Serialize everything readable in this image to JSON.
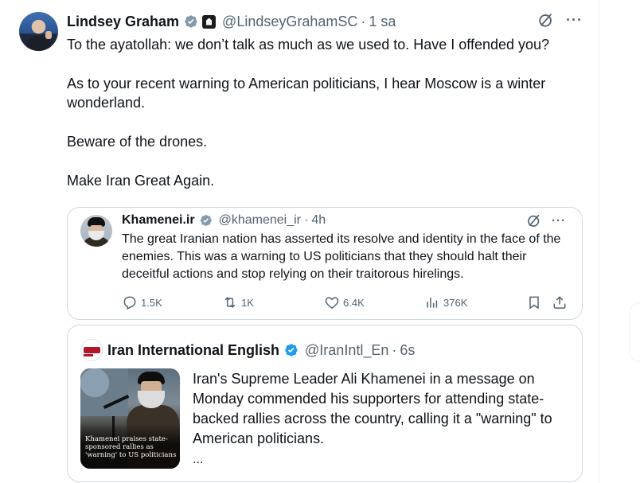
{
  "main_tweet": {
    "author_name": "Lindsey Graham",
    "handle": "@LindseyGrahamSC",
    "separator": "·",
    "time": "1 sa",
    "more_label": "···",
    "paragraphs": [
      "To the ayatollah: we don’t talk as much as we used to. Have I offended you?",
      "As to your recent warning to American politicians, I hear Moscow is a winter",
      "wonderland.",
      "Beware of the drones.",
      "Make Iran Great Again."
    ]
  },
  "quote_1": {
    "author_name": "Khamenei.ir",
    "handle": "@khamenei_ir",
    "separator": "·",
    "time": "4h",
    "more_label": "···",
    "text": "The great Iranian nation has asserted its resolve and identity in the face of the enemies. This was a warning to US politicians that they should halt their deceitful actions and stop relying on their traitorous hirelings.",
    "stats": {
      "replies": "1.5K",
      "reposts": "1K",
      "likes": "6.4K",
      "views": "376K"
    }
  },
  "quote_2": {
    "author_name": "Iran International English",
    "handle": "@IranIntl_En",
    "separator": "·",
    "time": "6s",
    "image_caption": "Khamenei praises state-sponsored rallies as 'warning' to US politicians",
    "text": "Iran's Supreme Leader Ali Khamenei in a message on Monday commended his supporters for attending state-backed rallies across the country, calling it a \"warning\" to American politicians.",
    "more": "..."
  },
  "colors": {
    "verified_blue": "#1d9bf0",
    "secondary_text": "#536471",
    "border": "#cfd9de",
    "primary_text": "#0f1419"
  },
  "icons": [
    "verified-badge-icon",
    "government-badge-icon",
    "grok-icon",
    "more-icon",
    "reply-icon",
    "repost-icon",
    "like-icon",
    "views-icon",
    "bookmark-icon",
    "share-icon"
  ]
}
